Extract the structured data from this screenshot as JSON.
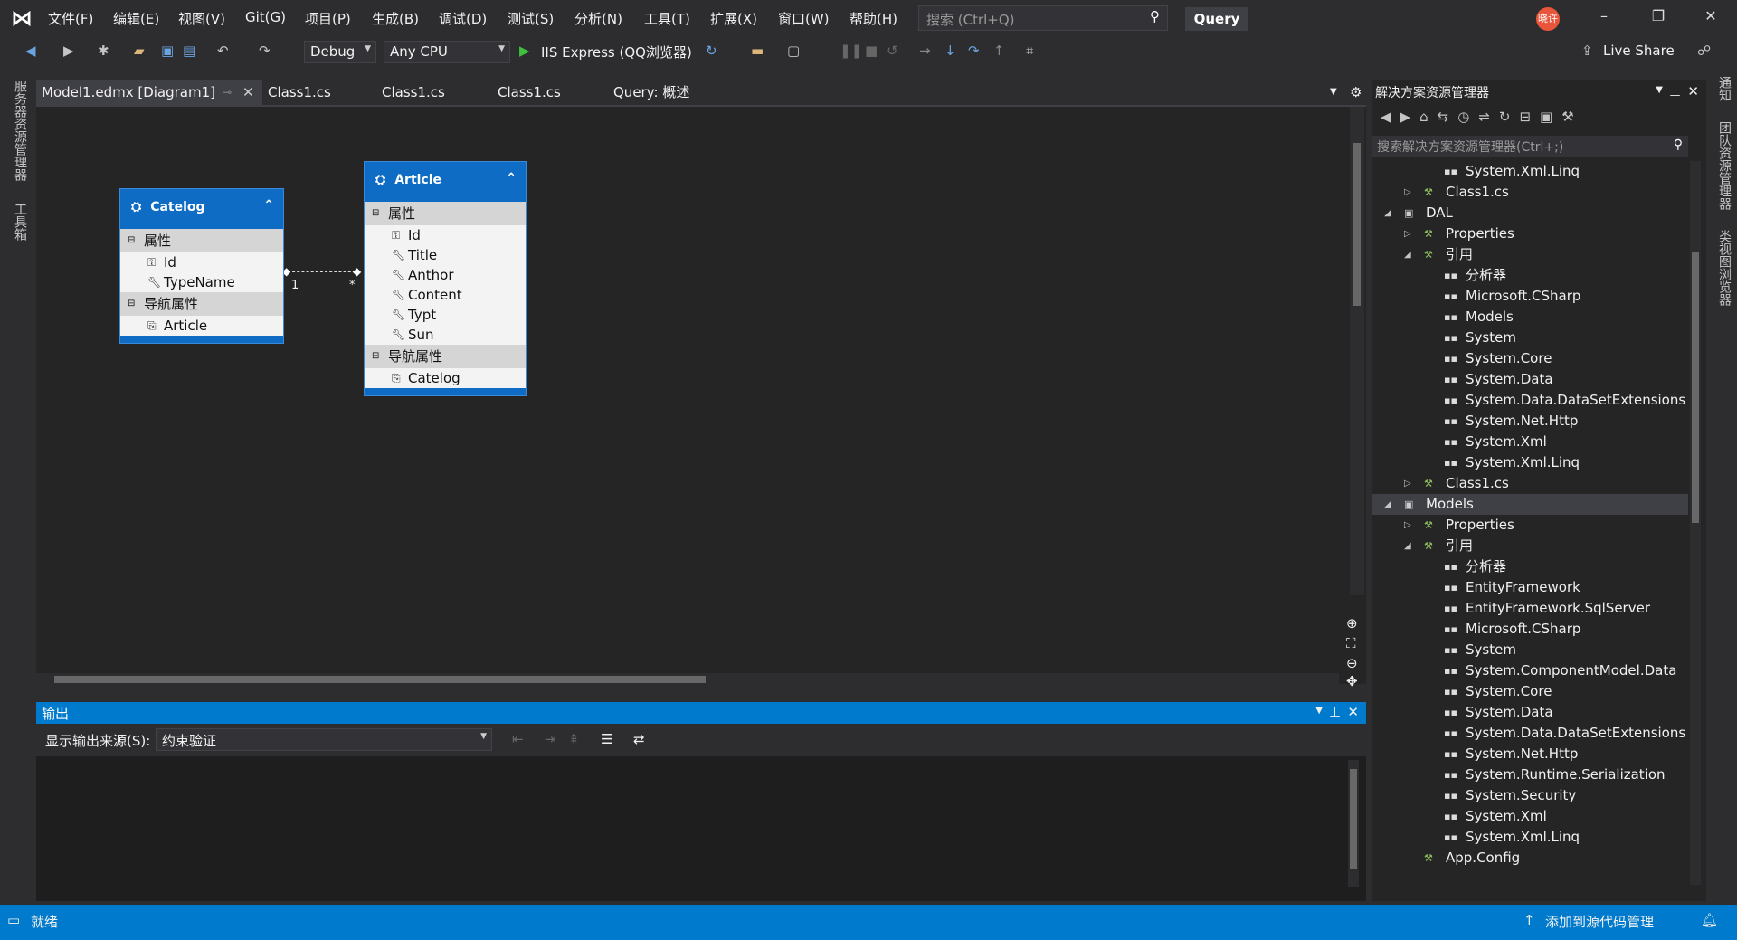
{
  "menu": [
    "文件(F)",
    "编辑(E)",
    "视图(V)",
    "Git(G)",
    "项目(P)",
    "生成(B)",
    "调试(D)",
    "测试(S)",
    "分析(N)",
    "工具(T)",
    "扩展(X)",
    "窗口(W)",
    "帮助(H)"
  ],
  "search": {
    "placeholder": "搜索 (Ctrl+Q)"
  },
  "query_button": "Query",
  "avatar": "晓许",
  "toolbar": {
    "config": "Debug",
    "platform": "Any CPU",
    "run": "IIS Express (QQ浏览器)",
    "live_share": "Live Share"
  },
  "left_rail": [
    "服务器资源管理器",
    "工具箱"
  ],
  "right_rail": [
    "通知",
    "团队资源管理器",
    "类视图浏览器"
  ],
  "tabs": [
    "Model1.edmx [Diagram1]",
    "Class1.cs",
    "Class1.cs",
    "Class1.cs",
    "Query: 概述"
  ],
  "entities": {
    "catelog": {
      "title": "Catelog",
      "props_header": "属性",
      "props": [
        "Id",
        "TypeName"
      ],
      "nav_header": "导航属性",
      "nav": [
        "Article"
      ]
    },
    "article": {
      "title": "Article",
      "props_header": "属性",
      "props": [
        "Id",
        "Title",
        "Anthor",
        "Content",
        "Typt",
        "Sun"
      ],
      "nav_header": "导航属性",
      "nav": [
        "Catelog"
      ]
    },
    "assoc": {
      "left": "1",
      "right": "*"
    }
  },
  "output": {
    "title": "输出",
    "source_label": "显示输出来源(S):",
    "source_value": "约束验证"
  },
  "solution": {
    "title": "解决方案资源管理器",
    "search_placeholder": "搜索解决方案资源管理器(Ctrl+;)",
    "rows": [
      {
        "t": "System.Xml.Linq",
        "l": 3
      },
      {
        "t": "Class1.cs",
        "l": 2,
        "e": "c"
      },
      {
        "t": "DAL",
        "l": 1,
        "e": "o"
      },
      {
        "t": "Properties",
        "l": 2,
        "e": "c"
      },
      {
        "t": "引用",
        "l": 2,
        "e": "o"
      },
      {
        "t": "分析器",
        "l": 3
      },
      {
        "t": "Microsoft.CSharp",
        "l": 3
      },
      {
        "t": "Models",
        "l": 3
      },
      {
        "t": "System",
        "l": 3
      },
      {
        "t": "System.Core",
        "l": 3
      },
      {
        "t": "System.Data",
        "l": 3
      },
      {
        "t": "System.Data.DataSetExtensions",
        "l": 3
      },
      {
        "t": "System.Net.Http",
        "l": 3
      },
      {
        "t": "System.Xml",
        "l": 3
      },
      {
        "t": "System.Xml.Linq",
        "l": 3
      },
      {
        "t": "Class1.cs",
        "l": 2,
        "e": "c"
      },
      {
        "t": "Models",
        "l": 1,
        "e": "o",
        "sel": true
      },
      {
        "t": "Properties",
        "l": 2,
        "e": "c"
      },
      {
        "t": "引用",
        "l": 2,
        "e": "o"
      },
      {
        "t": "分析器",
        "l": 3
      },
      {
        "t": "EntityFramework",
        "l": 3
      },
      {
        "t": "EntityFramework.SqlServer",
        "l": 3
      },
      {
        "t": "Microsoft.CSharp",
        "l": 3
      },
      {
        "t": "System",
        "l": 3
      },
      {
        "t": "System.ComponentModel.Data",
        "l": 3
      },
      {
        "t": "System.Core",
        "l": 3
      },
      {
        "t": "System.Data",
        "l": 3
      },
      {
        "t": "System.Data.DataSetExtensions",
        "l": 3
      },
      {
        "t": "System.Net.Http",
        "l": 3
      },
      {
        "t": "System.Runtime.Serialization",
        "l": 3
      },
      {
        "t": "System.Security",
        "l": 3
      },
      {
        "t": "System.Xml",
        "l": 3
      },
      {
        "t": "System.Xml.Linq",
        "l": 3
      },
      {
        "t": "App.Config",
        "l": 2
      }
    ]
  },
  "status": {
    "text": "就绪",
    "right": "添加到源代码管理"
  }
}
